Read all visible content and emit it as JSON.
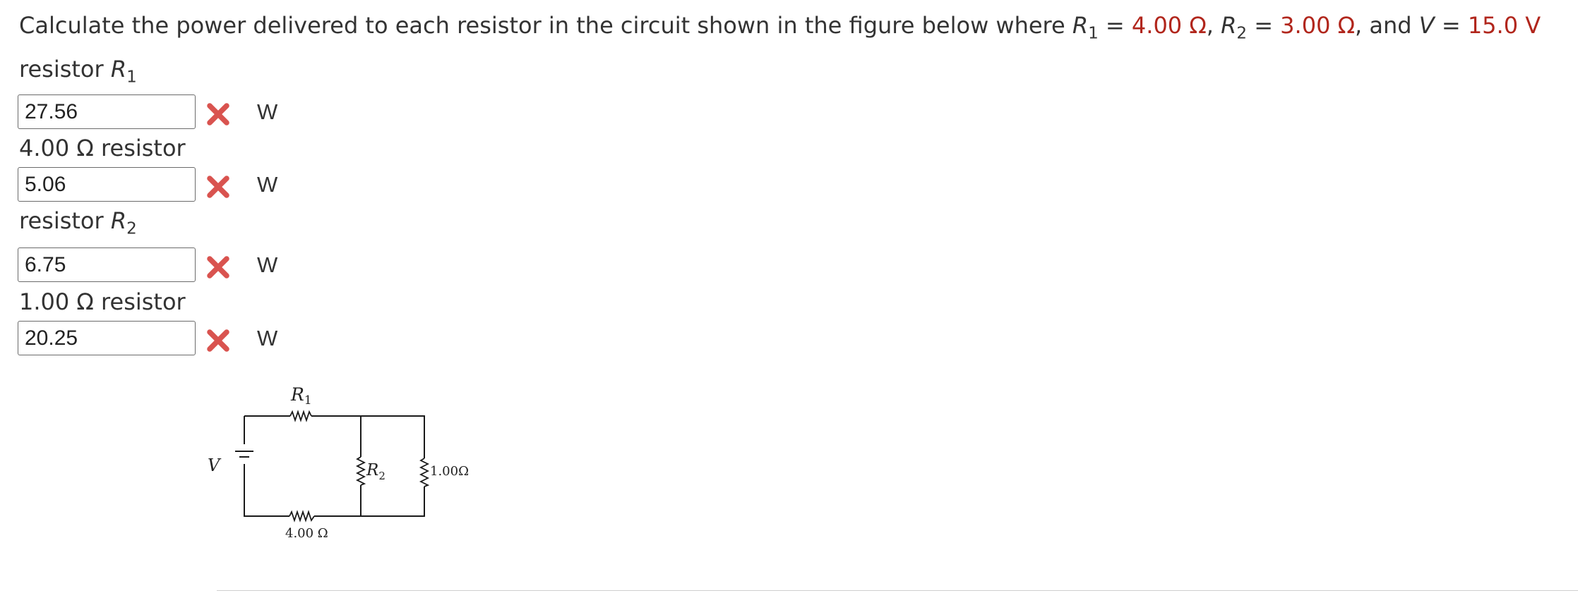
{
  "question": {
    "prefix": "Calculate the power delivered to each resistor in the circuit shown in the figure below where ",
    "r1_symbol": "R",
    "r1_sub": "1",
    "eq1": " = ",
    "r1_value": "4.00 Ω",
    "sep1": ", ",
    "r2_symbol": "R",
    "r2_sub": "2",
    "eq2": " = ",
    "r2_value": "3.00 Ω",
    "sep2": ", and ",
    "v_symbol": "V",
    "eq3": " = ",
    "v_value": "15.0 V"
  },
  "parts": [
    {
      "label_text": "resistor ",
      "label_symbol": "R",
      "label_sub": "1",
      "value": "27.56",
      "unit": "W",
      "status": "incorrect"
    },
    {
      "label_text": "4.00 Ω resistor",
      "value": "5.06",
      "unit": "W",
      "status": "incorrect"
    },
    {
      "label_text": "resistor ",
      "label_symbol": "R",
      "label_sub": "2",
      "value": "6.75",
      "unit": "W",
      "status": "incorrect"
    },
    {
      "label_text": "1.00 Ω resistor",
      "value": "20.25",
      "unit": "W",
      "status": "incorrect"
    }
  ],
  "figure": {
    "r1_label": "R",
    "r1_sub": "1",
    "r2_label": "R",
    "r2_sub": "2",
    "v_label": "V",
    "bottom_resistor_label": "4.00 Ω",
    "right_resistor_label": "1.00Ω"
  },
  "colors": {
    "given_value": "#b1261c",
    "wrong_mark": "#d9534f"
  }
}
